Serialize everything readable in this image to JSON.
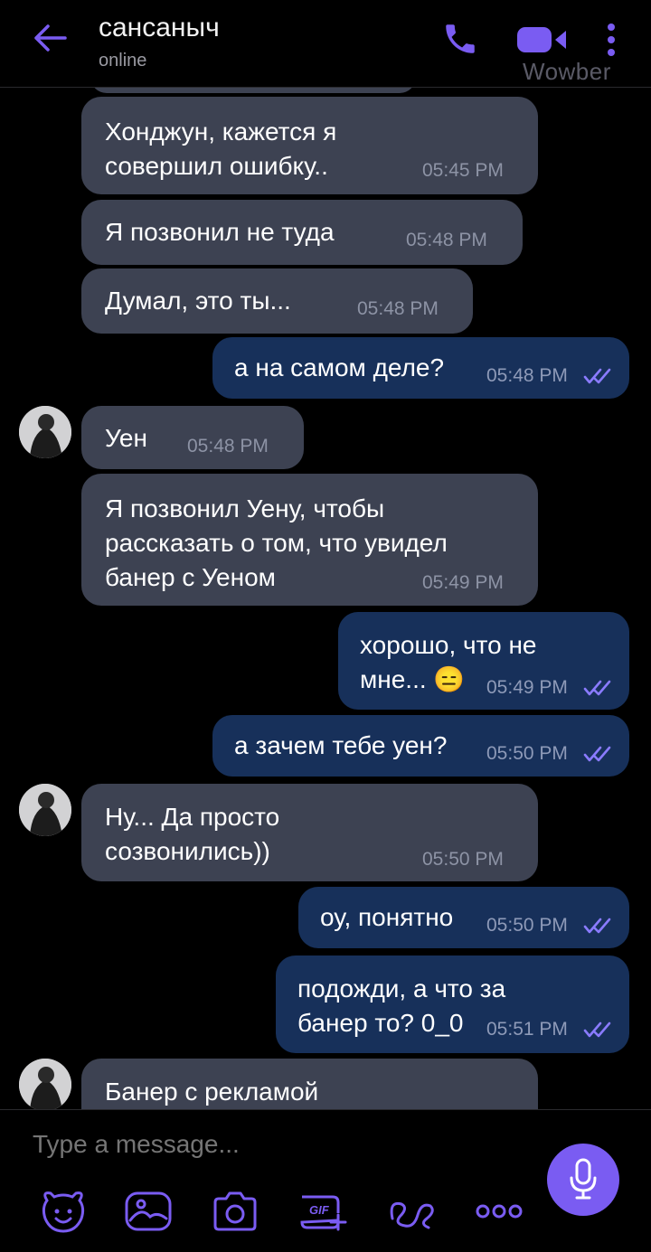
{
  "header": {
    "contact_name": "сансаныч",
    "status": "online",
    "watermark": "Wowber",
    "icons": [
      "back-arrow-icon",
      "phone-icon",
      "video-call-icon",
      "more-vertical-icon"
    ],
    "accent_color": "#7a5cf2"
  },
  "messages": [
    {
      "direction": "in",
      "text_lines": [
        "Хонджун, кажется я",
        "совершил ошибку.."
      ],
      "time": "05:45 PM"
    },
    {
      "direction": "in",
      "text_lines": [
        "Я позвонил не туда"
      ],
      "time": "05:48 PM"
    },
    {
      "direction": "in",
      "text_lines": [
        "Думал, это ты..."
      ],
      "time": "05:48 PM"
    },
    {
      "direction": "out",
      "text_lines": [
        "а на самом деле?"
      ],
      "time": "05:48 PM",
      "read": true
    },
    {
      "direction": "in",
      "avatar": true,
      "text_lines": [
        "Уен"
      ],
      "time": "05:48 PM"
    },
    {
      "direction": "in",
      "text_lines": [
        "Я позвонил Уену, чтобы",
        "рассказать о том, что увидел",
        "банер с Уеном"
      ],
      "time": "05:49 PM"
    },
    {
      "direction": "out",
      "text_lines": [
        "хорошо, что не",
        "мне... 😑"
      ],
      "time": "05:49 PM",
      "read": true
    },
    {
      "direction": "out",
      "text_lines": [
        "а зачем тебе уен?"
      ],
      "time": "05:50 PM",
      "read": true
    },
    {
      "direction": "in",
      "avatar": true,
      "text_lines": [
        "Ну... Да просто",
        "созвонились))"
      ],
      "time": "05:50 PM"
    },
    {
      "direction": "out",
      "text_lines": [
        "оу, понятно"
      ],
      "time": "05:50 PM",
      "read": true
    },
    {
      "direction": "out",
      "text_lines": [
        "подожди, а что за",
        "банер то? 0_0"
      ],
      "time": "05:51 PM",
      "read": true
    },
    {
      "direction": "in",
      "avatar": true,
      "text_lines": [
        "Банер с рекламой"
      ],
      "time": ""
    }
  ],
  "composer": {
    "placeholder": "Type a message...",
    "toolbar_icons": [
      "sticker-icon",
      "gallery-icon",
      "camera-icon",
      "gif-icon",
      "doodle-icon",
      "more-horizontal-icon"
    ],
    "gif_label": "GIF",
    "mic_icon": "microphone-icon"
  }
}
